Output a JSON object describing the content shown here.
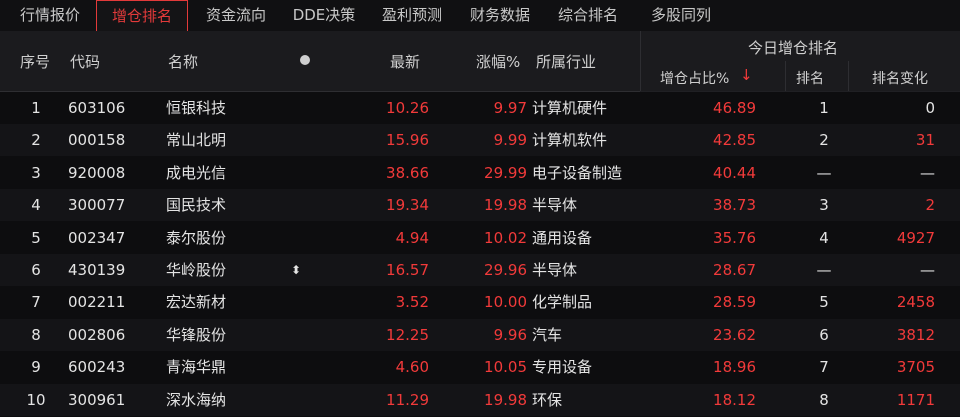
{
  "tabs": [
    "行情报价",
    "增仓排名",
    "资金流向",
    "DDE决策",
    "盈利预测",
    "财务数据",
    "综合排名",
    "多股同列"
  ],
  "header": {
    "seq": "序号",
    "code": "代码",
    "name": "名称",
    "latest": "最新",
    "change": "涨幅%",
    "industry": "所属行业",
    "group": "今日增仓排名",
    "ratio": "增仓占比%",
    "sort_arrow": "↓",
    "rank": "排名",
    "rank_change": "排名变化"
  },
  "rows": [
    {
      "seq": "1",
      "code": "603106",
      "name": "恒银科技",
      "mark": "",
      "latest": "10.26",
      "change": "9.97",
      "industry": "计算机硬件",
      "ratio": "46.89",
      "rank": "1",
      "rank_change": "0"
    },
    {
      "seq": "2",
      "code": "000158",
      "name": "常山北明",
      "mark": "",
      "latest": "15.96",
      "change": "9.99",
      "industry": "计算机软件",
      "ratio": "42.85",
      "rank": "2",
      "rank_change": "31"
    },
    {
      "seq": "3",
      "code": "920008",
      "name": "成电光信",
      "mark": "",
      "latest": "38.66",
      "change": "29.99",
      "industry": "电子设备制造",
      "ratio": "40.44",
      "rank": "—",
      "rank_change": "—"
    },
    {
      "seq": "4",
      "code": "300077",
      "name": "国民技术",
      "mark": "",
      "latest": "19.34",
      "change": "19.98",
      "industry": "半导体",
      "ratio": "38.73",
      "rank": "3",
      "rank_change": "2"
    },
    {
      "seq": "5",
      "code": "002347",
      "name": "泰尔股份",
      "mark": "",
      "latest": "4.94",
      "change": "10.02",
      "industry": "通用设备",
      "ratio": "35.76",
      "rank": "4",
      "rank_change": "4927"
    },
    {
      "seq": "6",
      "code": "430139",
      "name": "华岭股份",
      "mark": "⬍",
      "latest": "16.57",
      "change": "29.96",
      "industry": "半导体",
      "ratio": "28.67",
      "rank": "—",
      "rank_change": "—"
    },
    {
      "seq": "7",
      "code": "002211",
      "name": "宏达新材",
      "mark": "",
      "latest": "3.52",
      "change": "10.00",
      "industry": "化学制品",
      "ratio": "28.59",
      "rank": "5",
      "rank_change": "2458"
    },
    {
      "seq": "8",
      "code": "002806",
      "name": "华锋股份",
      "mark": "",
      "latest": "12.25",
      "change": "9.96",
      "industry": "汽车",
      "ratio": "23.62",
      "rank": "6",
      "rank_change": "3812"
    },
    {
      "seq": "9",
      "code": "600243",
      "name": "青海华鼎",
      "mark": "",
      "latest": "4.60",
      "change": "10.05",
      "industry": "专用设备",
      "ratio": "18.96",
      "rank": "7",
      "rank_change": "3705"
    },
    {
      "seq": "10",
      "code": "300961",
      "name": "深水海纳",
      "mark": "",
      "latest": "11.29",
      "change": "19.98",
      "industry": "环保",
      "ratio": "18.12",
      "rank": "8",
      "rank_change": "1171"
    }
  ]
}
